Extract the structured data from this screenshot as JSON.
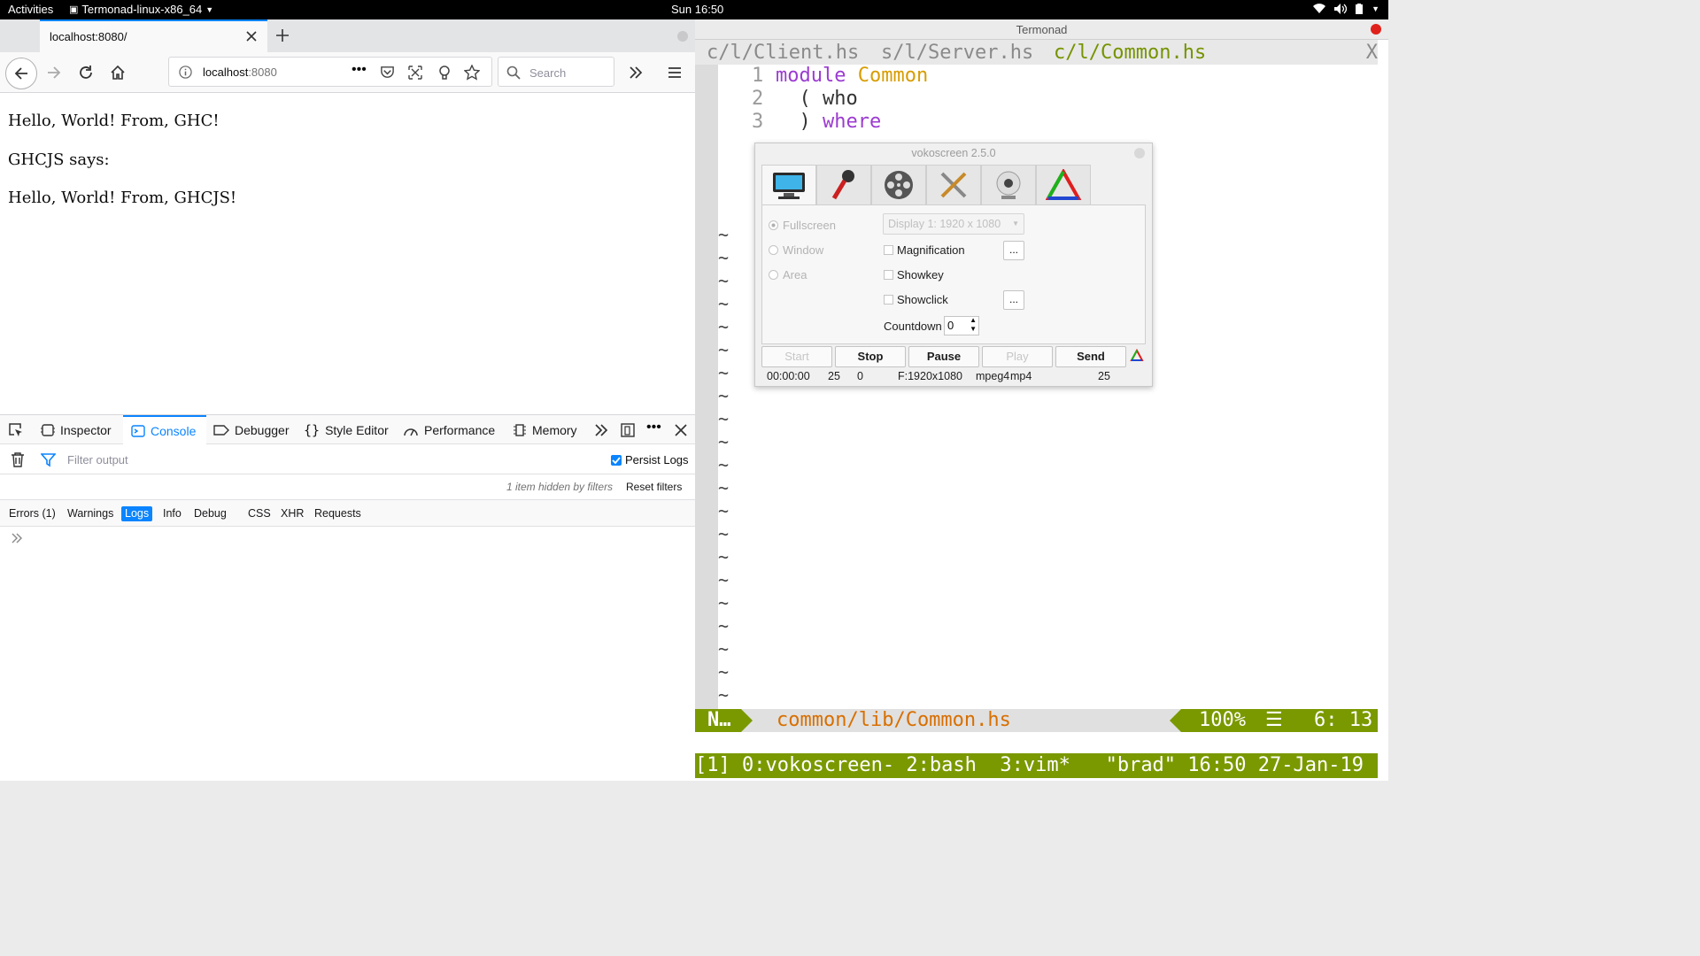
{
  "topbar": {
    "activities": "Activities",
    "app_name": "Termonad-linux-x86_64",
    "clock": "Sun 16:50"
  },
  "firefox": {
    "tab_title": "localhost:8080/",
    "url_host": "localhost",
    "url_port": ":8080",
    "search_placeholder": "Search",
    "page": {
      "line1": "Hello, World! From, GHC!",
      "line2": "GHCJS says:",
      "line3": "Hello, World! From, GHCJS!"
    },
    "devtools": {
      "tabs": [
        "Inspector",
        "Console",
        "Debugger",
        "Style Editor",
        "Performance",
        "Memory"
      ],
      "active_tab": "Console",
      "filter_placeholder": "Filter output",
      "persist_logs": "Persist Logs",
      "hidden_msg": "1 item hidden by filters",
      "reset_filters": "Reset filters",
      "levels": [
        "Errors (1)",
        "Warnings",
        "Logs",
        "Info",
        "Debug",
        "CSS",
        "XHR",
        "Requests"
      ],
      "active_level": "Logs"
    }
  },
  "terminal": {
    "title": "Termonad",
    "vim_tabs": [
      "c/l/Client.hs",
      "s/l/Server.hs",
      "c/l/Common.hs"
    ],
    "vim_tab_close": "X",
    "lines": [
      {
        "num": "1",
        "kw": "module",
        "rest": "Common"
      },
      {
        "num": "2",
        "kw": "",
        "rest": "( who"
      },
      {
        "num": "3",
        "kw": "where",
        "rest": ")"
      }
    ],
    "status_mode": "N…",
    "status_file": "common/lib/Common.hs",
    "status_percent": "100%",
    "status_menu": "☰",
    "status_pos": "6: 13",
    "tmux_line": "[1] 0:vokoscreen- 2:bash  3:vim*   \"brad\" 16:50 27-Jan-19"
  },
  "vokoscreen": {
    "title": "vokoscreen 2.5.0",
    "tab_icons": [
      "monitor-icon",
      "microphone-icon",
      "film-reel-icon",
      "tools-icon",
      "webcam-icon",
      "triangle-icon"
    ],
    "modes": [
      "Fullscreen",
      "Window",
      "Area"
    ],
    "display": "Display 1:  1920 x 1080",
    "options": [
      "Magnification",
      "Showkey",
      "Showclick"
    ],
    "dots": "...",
    "countdown_label": "Countdown",
    "countdown_value": "0",
    "buttons": [
      "Start",
      "Stop",
      "Pause",
      "Play",
      "Send"
    ],
    "info": {
      "time": "00:00:00",
      "fps": "25",
      "frames": "0",
      "format": "F:1920x1080",
      "codec": "mpeg4",
      "container": "mp4",
      "fps2": "25"
    }
  }
}
